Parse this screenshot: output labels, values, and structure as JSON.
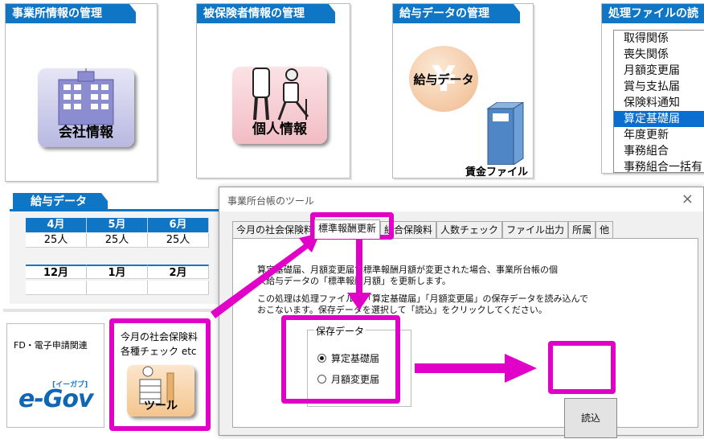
{
  "panels": {
    "office": {
      "title": "事業所情報の管理",
      "icon_label": "会社情報"
    },
    "insured": {
      "title": "被保険者情報の管理",
      "icon_label": "個人情報"
    },
    "salary": {
      "title": "給与データの管理",
      "icon_label": "給与データ",
      "file_label": "賃金ファイル"
    },
    "processing": {
      "title": "処理ファイルの読",
      "items": [
        "取得関係",
        "喪失関係",
        "月額変更届",
        "賞与支払届",
        "保険料通知",
        "算定基礎届",
        "年度更新",
        "事務組合",
        "事務組合一括有"
      ],
      "selected_index": 5
    }
  },
  "salary_data": {
    "title": "給与データ",
    "row1_months": [
      "4月",
      "5月",
      "6月"
    ],
    "row1_counts": [
      "25人",
      "25人",
      "25人"
    ],
    "row2_months": [
      "12月",
      "1月",
      "2月"
    ]
  },
  "tiles": {
    "egov": {
      "title": "FD・電子申請関連",
      "logo": "e-Gov",
      "logo_sub": "[イーガブ]"
    },
    "tools": {
      "line1": "今月の社会保険料",
      "line2": "各種チェック etc",
      "icon_label": "ツール"
    }
  },
  "dialog": {
    "title": "事業所台帳のツール",
    "close": "×",
    "tabs": [
      "今月の社会保険料",
      "標準報酬更新",
      "組合保険料",
      "人数チェック",
      "ファイル出力",
      "所属",
      "他"
    ],
    "active_tab": "標準報酬更新",
    "description": [
      "算定基礎届、月額変更届で標準報酬月額が変更された場合、事業所台帳の個",
      "人給与データの「標準報酬月額」を更新します。",
      "この処理は処理ファイルの「算定基礎届」「月額変更届」の保存データを読み込んで",
      "おこないます。保存データを選択して「読込」をクリックしてください。"
    ],
    "group_label": "保存データ",
    "options": [
      "算定基礎届",
      "月額変更届"
    ],
    "selected_option": "算定基礎届",
    "read_button": "読込"
  },
  "colors": {
    "header_blue": "#0f76c5",
    "highlight_magenta": "#e000c8",
    "selection_blue": "#0a6ed1"
  }
}
